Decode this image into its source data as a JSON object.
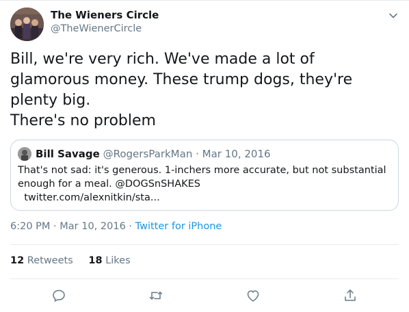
{
  "tweet": {
    "author_name": "The Wieners Circle",
    "author_handle": "@TheWienerCircle",
    "text": "Bill, we're very rich. We've made a lot of glamorous money. These trump dogs, they're plenty big.\nThere's no problem",
    "quote": {
      "name": "Bill Savage",
      "handle": "@RogersParkMan",
      "separator": "·",
      "date": "Mar 10, 2016",
      "text": "That's not sad: it's generous. 1-inchers more accurate, but not substantial enough for a meal. @DOGSnSHAKES\n  twitter.com/alexnitkin/sta..."
    },
    "time": "6:20 PM",
    "meta_separator": "·",
    "date": "Mar 10, 2016",
    "source": "Twitter for iPhone",
    "retweets": {
      "count": "12",
      "label": "Retweets"
    },
    "likes": {
      "count": "18",
      "label": "Likes"
    }
  },
  "icons": {
    "more": "chevron-down-icon",
    "reply": "reply-icon",
    "retweet": "retweet-icon",
    "like": "heart-icon",
    "share": "share-icon"
  },
  "colors": {
    "text": "#14171a",
    "secondary": "#657786",
    "link": "#1b95e0",
    "border": "#e6ecf0"
  }
}
